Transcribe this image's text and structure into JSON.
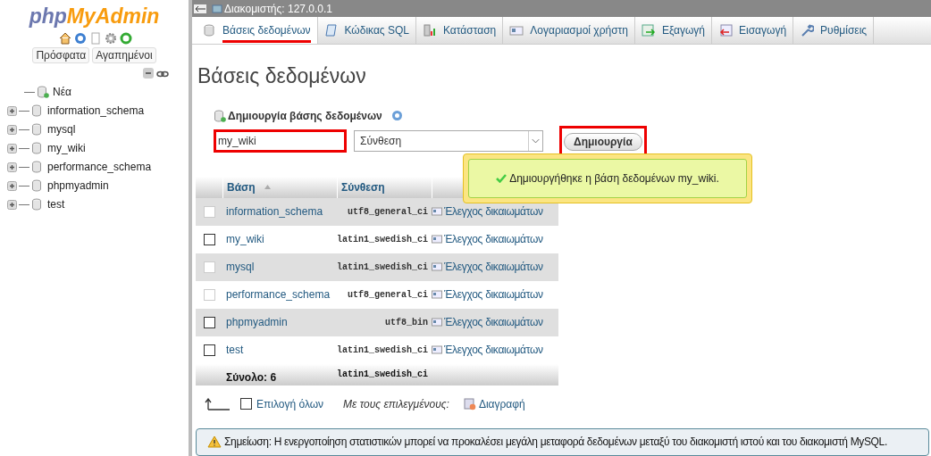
{
  "sidebar": {
    "logo": {
      "part_1": "php",
      "part_2": "MyAdmin"
    },
    "buttons": [
      "Πρόσφατα",
      "Αγαπημένοι"
    ],
    "tree": [
      {
        "name": "Νέα",
        "kind": "new"
      },
      {
        "name": "information_schema",
        "kind": "db"
      },
      {
        "name": "mysql",
        "kind": "db"
      },
      {
        "name": "my_wiki",
        "kind": "db"
      },
      {
        "name": "performance_schema",
        "kind": "db"
      },
      {
        "name": "phpmyadmin",
        "kind": "db"
      },
      {
        "name": "test",
        "kind": "db"
      }
    ]
  },
  "breadcrumb": "Διακομιστής: 127.0.0.1",
  "tabs": [
    {
      "label": "Βάσεις δεδομένων",
      "selected": true,
      "underlined": true
    },
    {
      "label": "Κώδικας SQL",
      "selected": false,
      "underlined": false
    },
    {
      "label": "Κατάσταση",
      "selected": false,
      "underlined": false
    },
    {
      "label": "Λογαριασμοί χρήστη",
      "selected": false,
      "underlined": false
    },
    {
      "label": "Εξαγωγή",
      "selected": false,
      "underlined": false
    },
    {
      "label": "Εισαγωγή",
      "selected": false,
      "underlined": false
    },
    {
      "label": "Ρυθμίσεις",
      "selected": false,
      "underlined": false
    }
  ],
  "page_title": "Βάσεις δεδομένων",
  "create": {
    "heading": "Δημιουργία βάσης δεδομένων",
    "name_value": "my_wiki",
    "name_highlighted": true,
    "collation_value": "Σύνθεση",
    "button": "Δημιουργία",
    "button_highlighted": true
  },
  "message": "Δημιουργήθηκε η βάση δεδομένων my_wiki.",
  "table": {
    "columns": [
      "Βάση",
      "Σύνθεση"
    ],
    "rows": [
      {
        "name": "information_schema",
        "collation": "utf8_general_ci",
        "action": "Έλεγχος δικαιωμάτων",
        "checked": false,
        "disabled": true
      },
      {
        "name": "my_wiki",
        "collation": "latin1_swedish_ci",
        "action": "Έλεγχος δικαιωμάτων",
        "checked": false,
        "disabled": false
      },
      {
        "name": "mysql",
        "collation": "latin1_swedish_ci",
        "action": "Έλεγχος δικαιωμάτων",
        "checked": false,
        "disabled": true
      },
      {
        "name": "performance_schema",
        "collation": "utf8_general_ci",
        "action": "Έλεγχος δικαιωμάτων",
        "checked": false,
        "disabled": true
      },
      {
        "name": "phpmyadmin",
        "collation": "utf8_bin",
        "action": "Έλεγχος δικαιωμάτων",
        "checked": false,
        "disabled": false
      },
      {
        "name": "test",
        "collation": "latin1_swedish_ci",
        "action": "Έλεγχος δικαιωμάτων",
        "checked": false,
        "disabled": false
      }
    ],
    "total_label": "Σύνολο: 6",
    "total_collation": "latin1_swedish_ci"
  },
  "footer": {
    "select_all": "Επιλογή όλων",
    "select_all_checked": false,
    "with_selected": "Με τους επιλεγμένους:",
    "delete": "Διαγραφή"
  },
  "notice": "Σημείωση: Η ενεργοποίηση στατιστικών μπορεί να προκαλέσει μεγάλη μεταφορά δεδομένων μεταξύ του διακομιστή ιστού και του διακομιστή MySQL."
}
